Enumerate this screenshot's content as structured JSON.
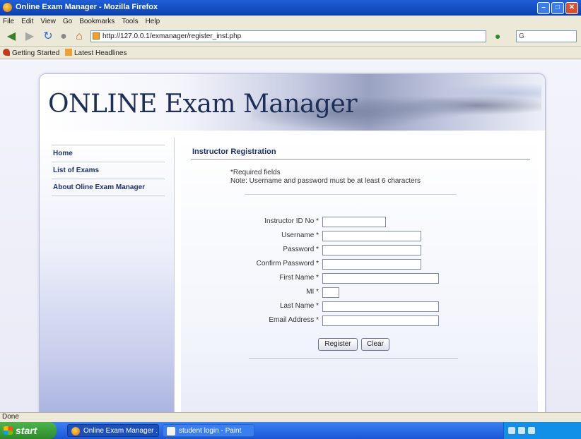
{
  "window": {
    "title": "Online Exam Manager - Mozilla Firefox"
  },
  "menu": [
    "File",
    "Edit",
    "View",
    "Go",
    "Bookmarks",
    "Tools",
    "Help"
  ],
  "toolbar": {
    "url": "http://127.0.0.1/exmanager/register_inst.php",
    "search_placeholder": "G"
  },
  "bookmarks": [
    "Getting Started",
    "Latest Headlines"
  ],
  "site": {
    "logo_part1": "ONLINE Exam",
    "logo_part2": " Manager",
    "nav": [
      "Home",
      "List of Exams",
      "About Oline Exam Manager"
    ]
  },
  "form": {
    "section_title": "Instructor Registration",
    "required_note": "*Required fields",
    "length_note": "Note: Username and password must be at least 6 characters",
    "fields": [
      {
        "label": "Instructor ID No",
        "value": ""
      },
      {
        "label": "Username",
        "value": ""
      },
      {
        "label": "Password",
        "value": ""
      },
      {
        "label": "Confirm Password",
        "value": ""
      },
      {
        "label": "First Name",
        "value": ""
      },
      {
        "label": "MI",
        "value": ""
      },
      {
        "label": "Last Name",
        "value": ""
      },
      {
        "label": "Email Address",
        "value": ""
      }
    ],
    "required_mark": "*",
    "register_label": "Register",
    "clear_label": "Clear"
  },
  "status": {
    "text": "Done"
  },
  "taskbar": {
    "start_label": "start",
    "tasks": [
      "Online Exam Manager ...",
      "student login - Paint"
    ]
  },
  "colors": {
    "accent": "#1e2f6e",
    "taskbar": "#245edb",
    "start": "#3c9a3a"
  }
}
